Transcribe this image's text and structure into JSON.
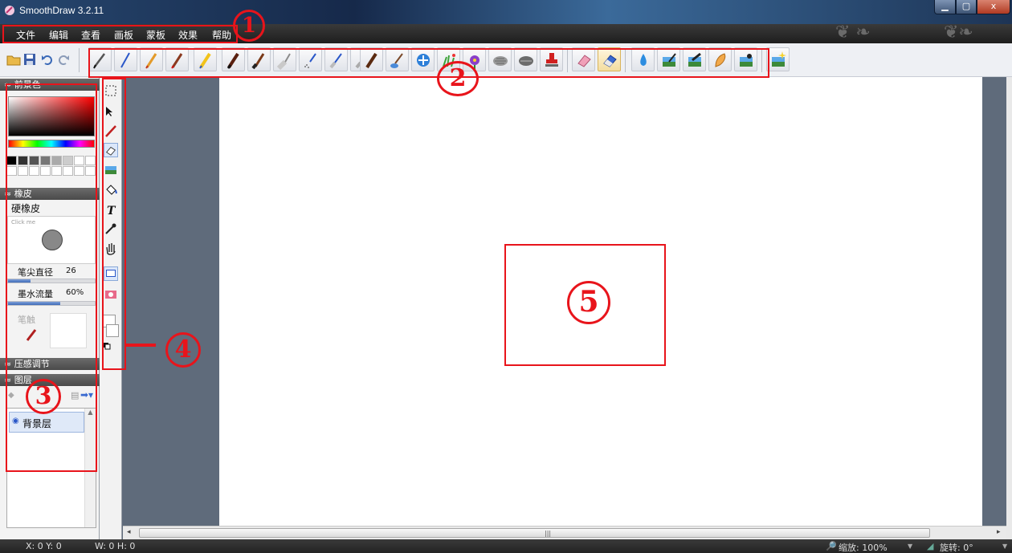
{
  "window": {
    "title": "SmoothDraw 3.2.11",
    "min_icon": "minimize-icon",
    "max_icon": "maximize-icon",
    "close_label": "x"
  },
  "menu": [
    "文件",
    "编辑",
    "查看",
    "画板",
    "蒙板",
    "效果",
    "帮助"
  ],
  "toolbar": {
    "quick_icons": [
      "open-folder-icon",
      "save-icon",
      "undo-icon",
      "redo-icon"
    ],
    "brush_icons": [
      "pen-icon",
      "blue-pen-icon",
      "pencil-icon",
      "red-pencil-icon",
      "crayon-icon",
      "marker-icon",
      "brush-icon",
      "flat-brush-icon",
      "airbrush-icon",
      "spray-icon",
      "fine-spray-icon",
      "oil-brush-icon",
      "water-brush-icon",
      "blur-icon",
      "grass-icon",
      "flower-icon",
      "texture-icon",
      "chalk-icon",
      "stamp-icon",
      "eraser-icon",
      "soft-eraser-icon",
      "water-drop-icon",
      "image-brush-icon",
      "image-stamp-icon",
      "finger-smudge-icon",
      "image-fill-icon",
      "sparkle-image-icon"
    ],
    "active_brush": "soft-eraser-icon"
  },
  "left_panel": {
    "foreground_header": "前景色",
    "eraser_header": "橡皮",
    "eraser_name": "硬橡皮",
    "preview_hint": "Click me",
    "tip_diameter_label": "笔尖直径",
    "tip_diameter_value": "26",
    "tip_diameter_fraction": 0.26,
    "ink_flow_label": "墨水流量",
    "ink_flow_value": "60%",
    "ink_flow_fraction": 0.6,
    "tip_label": "笔触",
    "pressure_header": "压感调节",
    "layers_header": "图层",
    "layer_name": "背景层",
    "colors": {
      "selected": "#000000"
    }
  },
  "tools": [
    "rect-select-icon",
    "move-icon",
    "brush-tool-icon",
    "eraser-tool-icon",
    "image-tool-icon",
    "fill-tool-icon",
    "text-tool-icon",
    "eyedropper-icon",
    "hand-icon",
    "rect-shape-icon",
    "mask-icon",
    "color-swap-icon"
  ],
  "status": {
    "xy": "X: 0 Y: 0",
    "wh": "W: 0 H: 0",
    "zoom": "缩放: 100%",
    "rotate": "旋转: 0°"
  },
  "annotations": [
    "1",
    "2",
    "3",
    "4",
    "5"
  ]
}
